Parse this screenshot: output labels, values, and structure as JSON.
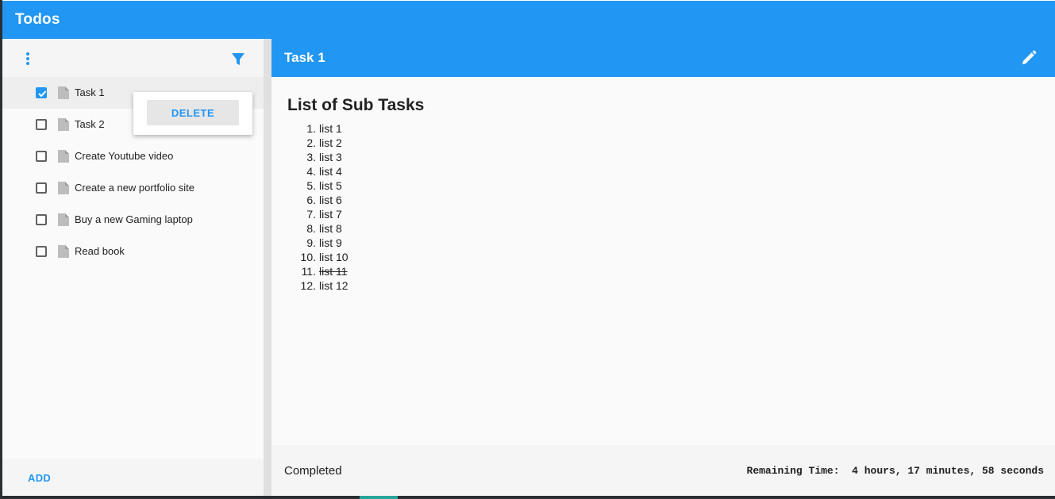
{
  "app": {
    "title": "Todos"
  },
  "colors": {
    "primary": "#2196f3",
    "check_accent": "#2196f3"
  },
  "left_toolbar": {
    "menu_icon": "more-vertical-icon",
    "filter_icon": "filter-icon"
  },
  "tasks": [
    {
      "label": "Task 1",
      "checked": true,
      "selected": true
    },
    {
      "label": "Task 2",
      "checked": false,
      "selected": false
    },
    {
      "label": "Create Youtube video",
      "checked": false,
      "selected": false
    },
    {
      "label": "Create a new portfolio site",
      "checked": false,
      "selected": false
    },
    {
      "label": "Buy a new Gaming laptop",
      "checked": false,
      "selected": false
    },
    {
      "label": "Read book",
      "checked": false,
      "selected": false
    }
  ],
  "context_menu": {
    "delete_label": "DELETE"
  },
  "left_footer": {
    "add_label": "ADD"
  },
  "detail": {
    "title": "Task 1",
    "edit_icon": "pencil-icon",
    "heading": "List of Sub Tasks",
    "subtasks": [
      {
        "num": "1.",
        "text": "list 1",
        "done": false
      },
      {
        "num": "2.",
        "text": "list 2",
        "done": false
      },
      {
        "num": "3.",
        "text": "list 3",
        "done": false
      },
      {
        "num": "4.",
        "text": "list 4",
        "done": false
      },
      {
        "num": "5.",
        "text": "list 5",
        "done": false
      },
      {
        "num": "6.",
        "text": "list 6",
        "done": false
      },
      {
        "num": "7.",
        "text": "list 7",
        "done": false
      },
      {
        "num": "8.",
        "text": "list 8",
        "done": false
      },
      {
        "num": "9.",
        "text": "list 9",
        "done": false
      },
      {
        "num": "10.",
        "text": "list 10",
        "done": false
      },
      {
        "num": "11.",
        "text": "list 11",
        "done": true
      },
      {
        "num": "12.",
        "text": "list 12",
        "done": false
      }
    ],
    "status": "Completed",
    "remaining_label": "Remaining Time:",
    "remaining_value": "4 hours, 17 minutes, 58 seconds"
  }
}
